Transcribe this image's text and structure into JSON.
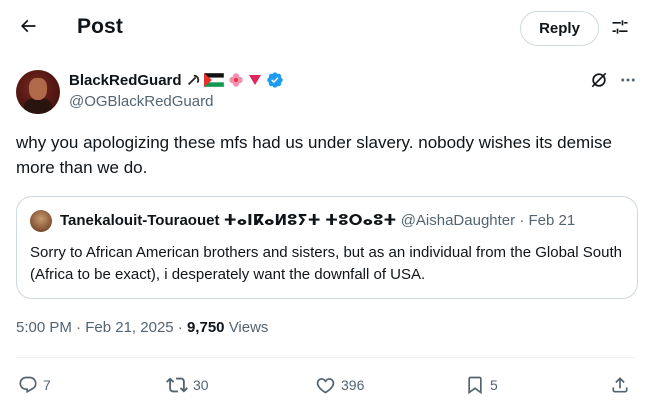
{
  "header": {
    "title": "Post",
    "reply_label": "Reply"
  },
  "post": {
    "author": {
      "display_name": "BlackRedGuard",
      "handle": "@OGBlackRedGuard",
      "emojis": [
        "hammer-sickle-emoji",
        "palestine-flag-emoji",
        "hibiscus-emoji",
        "red-triangle-emoji"
      ],
      "verified": true
    },
    "text": "why you apologizing these mfs had us under slavery. nobody wishes its demise more than we do.",
    "quoted": {
      "display_name": "Tanekalouit-Touraouet ⵜⴰⵏⴽⴰⵍⵓⵢⵜ ⵜⵓⵔⴰⵓⵜ",
      "handle": "@AishaDaughter",
      "separator": "·",
      "date": "Feb 21",
      "text": "Sorry to African American brothers and sisters, but as an individual from the Global South (Africa to be exact), i desperately want the downfall of USA."
    },
    "time": "5:00 PM",
    "dot": "·",
    "date": "Feb 21, 2025",
    "views_count": "9,750",
    "views_label": "Views"
  },
  "actions": {
    "replies": "7",
    "reposts": "30",
    "likes": "396",
    "bookmarks": "5"
  },
  "colors": {
    "text_primary": "#0f1419",
    "text_secondary": "#536471",
    "border": "#cfd9de",
    "verified_blue": "#1d9bf0"
  }
}
